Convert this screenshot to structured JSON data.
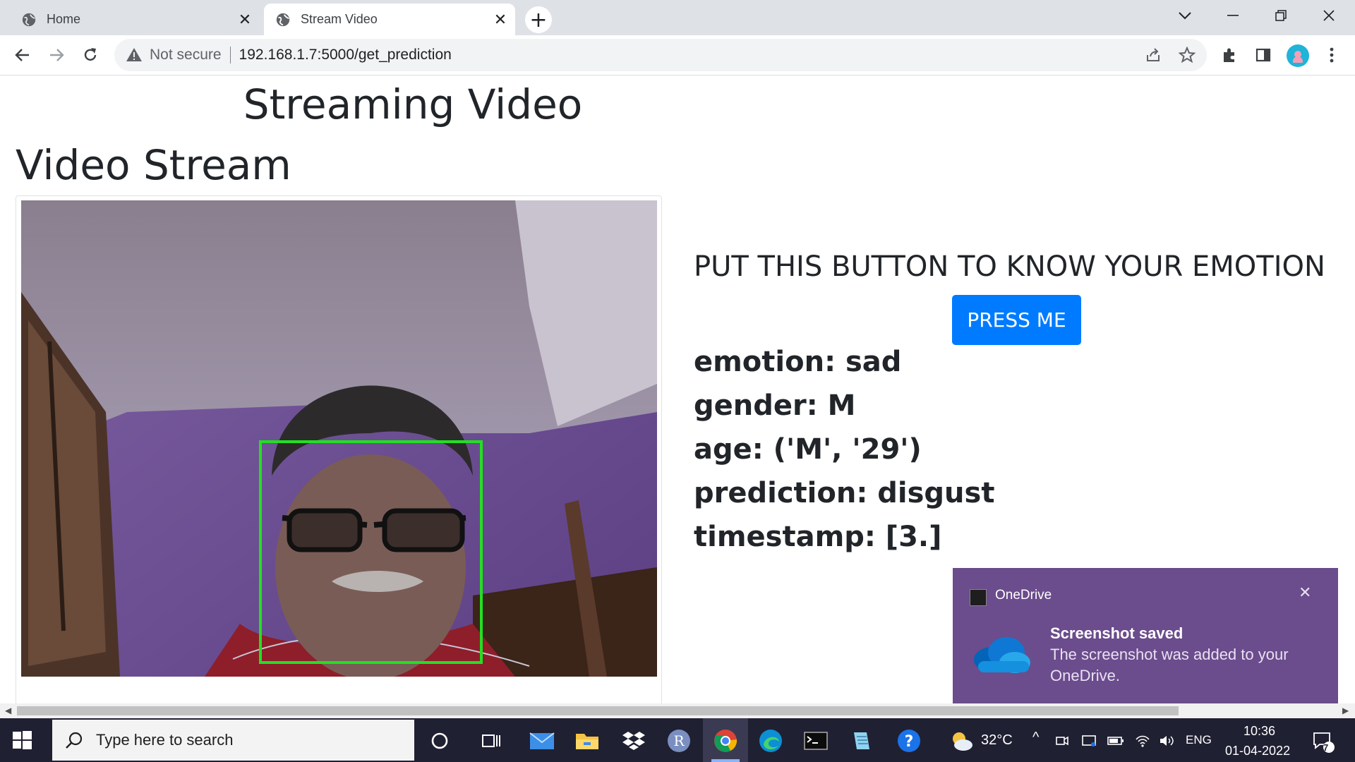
{
  "browser": {
    "tabs": [
      {
        "title": "Home",
        "active": false
      },
      {
        "title": "Stream Video",
        "active": true
      }
    ],
    "address": {
      "security_label": "Not secure",
      "url": "192.168.1.7:5000/get_prediction"
    }
  },
  "page": {
    "heading": "Streaming Video",
    "section_heading": "Video Stream",
    "instruction": "PUT THIS BUTTON TO KNOW YOUR EMOTION",
    "button_label": "PRESS ME",
    "results": {
      "emotion": "emotion: sad",
      "gender": "gender: M",
      "age": "age: ('M', '29')",
      "prediction": "prediction: disgust",
      "timestamp": "timestamp: [3.]"
    }
  },
  "notification": {
    "app": "OneDrive",
    "title": "Screenshot saved",
    "body": "The screenshot was added to your OneDrive."
  },
  "taskbar": {
    "search_placeholder": "Type here to search",
    "weather": "32°C",
    "language": "ENG",
    "time": "10:36",
    "date": "01-04-2022",
    "notification_count": "7"
  },
  "colors": {
    "button": "#007bff",
    "face_box": "#22e022",
    "toast": "#6b4c8c",
    "taskbar": "#202033"
  }
}
